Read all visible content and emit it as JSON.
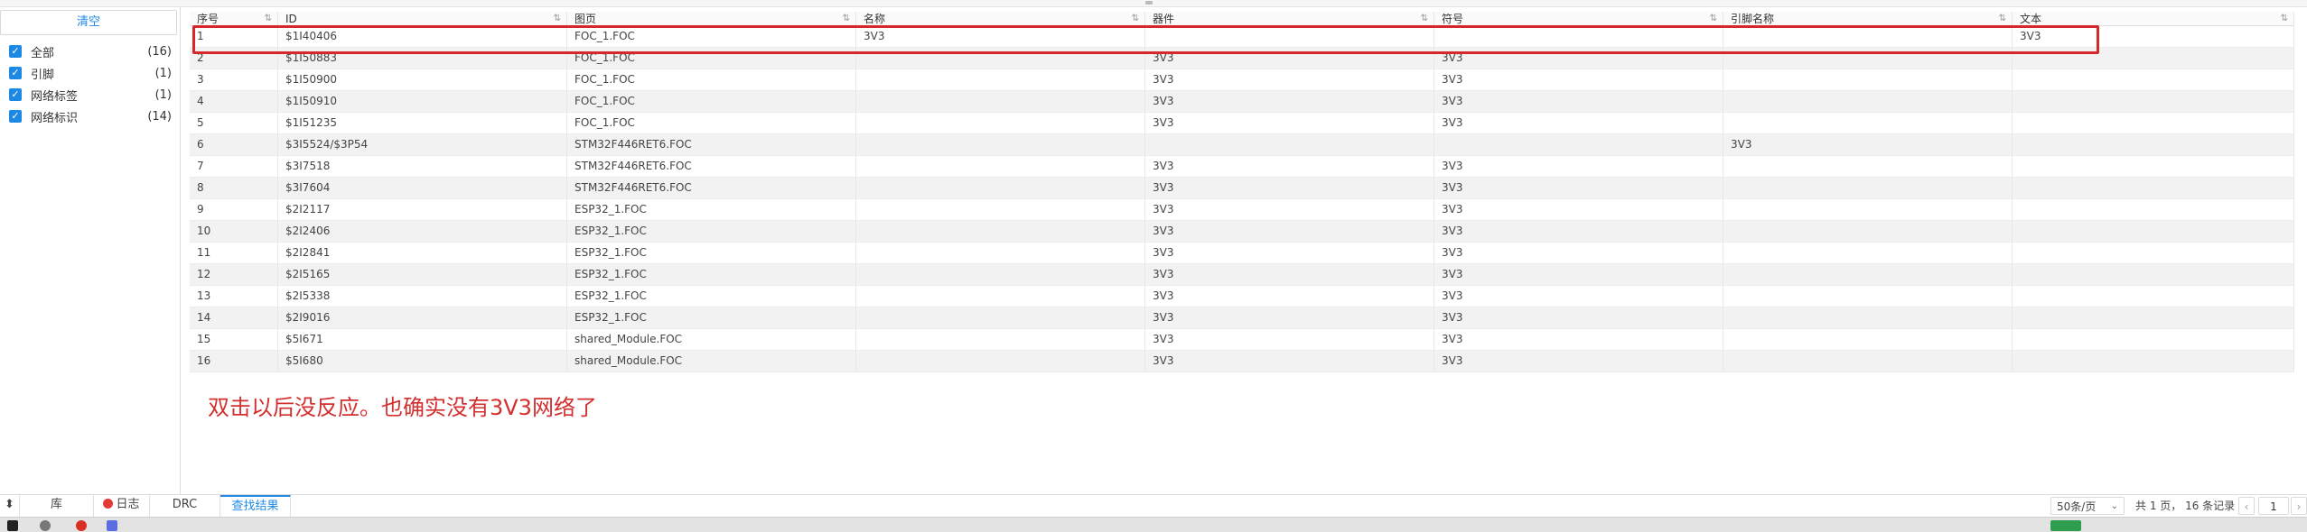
{
  "left_panel": {
    "clear_label": "清空",
    "filters": [
      {
        "label": "全部",
        "count": "(16)"
      },
      {
        "label": "引脚",
        "count": "(1)"
      },
      {
        "label": "网络标签",
        "count": "(1)"
      },
      {
        "label": "网络标识",
        "count": "(14)"
      }
    ]
  },
  "table": {
    "sort_glyph": "⇅",
    "headers": [
      "序号",
      "ID",
      "图页",
      "名称",
      "器件",
      "符号",
      "引脚名称",
      "文本"
    ],
    "rows": [
      [
        "1",
        "$1I40406",
        "FOC_1.FOC",
        "3V3",
        "",
        "",
        "",
        "3V3"
      ],
      [
        "2",
        "$1I50883",
        "FOC_1.FOC",
        "",
        "3V3",
        "3V3",
        "",
        ""
      ],
      [
        "3",
        "$1I50900",
        "FOC_1.FOC",
        "",
        "3V3",
        "3V3",
        "",
        ""
      ],
      [
        "4",
        "$1I50910",
        "FOC_1.FOC",
        "",
        "3V3",
        "3V3",
        "",
        ""
      ],
      [
        "5",
        "$1I51235",
        "FOC_1.FOC",
        "",
        "3V3",
        "3V3",
        "",
        ""
      ],
      [
        "6",
        "$3I5524/$3P54",
        "STM32F446RET6.FOC",
        "",
        "",
        "",
        "3V3",
        ""
      ],
      [
        "7",
        "$3I7518",
        "STM32F446RET6.FOC",
        "",
        "3V3",
        "3V3",
        "",
        ""
      ],
      [
        "8",
        "$3I7604",
        "STM32F446RET6.FOC",
        "",
        "3V3",
        "3V3",
        "",
        ""
      ],
      [
        "9",
        "$2I2117",
        "ESP32_1.FOC",
        "",
        "3V3",
        "3V3",
        "",
        ""
      ],
      [
        "10",
        "$2I2406",
        "ESP32_1.FOC",
        "",
        "3V3",
        "3V3",
        "",
        ""
      ],
      [
        "11",
        "$2I2841",
        "ESP32_1.FOC",
        "",
        "3V3",
        "3V3",
        "",
        ""
      ],
      [
        "12",
        "$2I5165",
        "ESP32_1.FOC",
        "",
        "3V3",
        "3V3",
        "",
        ""
      ],
      [
        "13",
        "$2I5338",
        "ESP32_1.FOC",
        "",
        "3V3",
        "3V3",
        "",
        ""
      ],
      [
        "14",
        "$2I9016",
        "ESP32_1.FOC",
        "",
        "3V3",
        "3V3",
        "",
        ""
      ],
      [
        "15",
        "$5I671",
        "shared_Module.FOC",
        "",
        "3V3",
        "3V3",
        "",
        ""
      ],
      [
        "16",
        "$5I680",
        "shared_Module.FOC",
        "",
        "3V3",
        "3V3",
        "",
        ""
      ]
    ]
  },
  "annotation": {
    "text": "双击以后没反应。也确实没有3V3网络了",
    "color": "#d32f2f"
  },
  "bottom_tabs": [
    "库",
    "日志",
    "DRC",
    "查找结果"
  ],
  "pager": {
    "page_size": "50条/页",
    "summary": "共 1 页，  16 条记录",
    "prev": "‹",
    "page": "1",
    "next": "›"
  },
  "colors": {
    "accent": "#1e88e5",
    "highlight": "#d62828"
  }
}
